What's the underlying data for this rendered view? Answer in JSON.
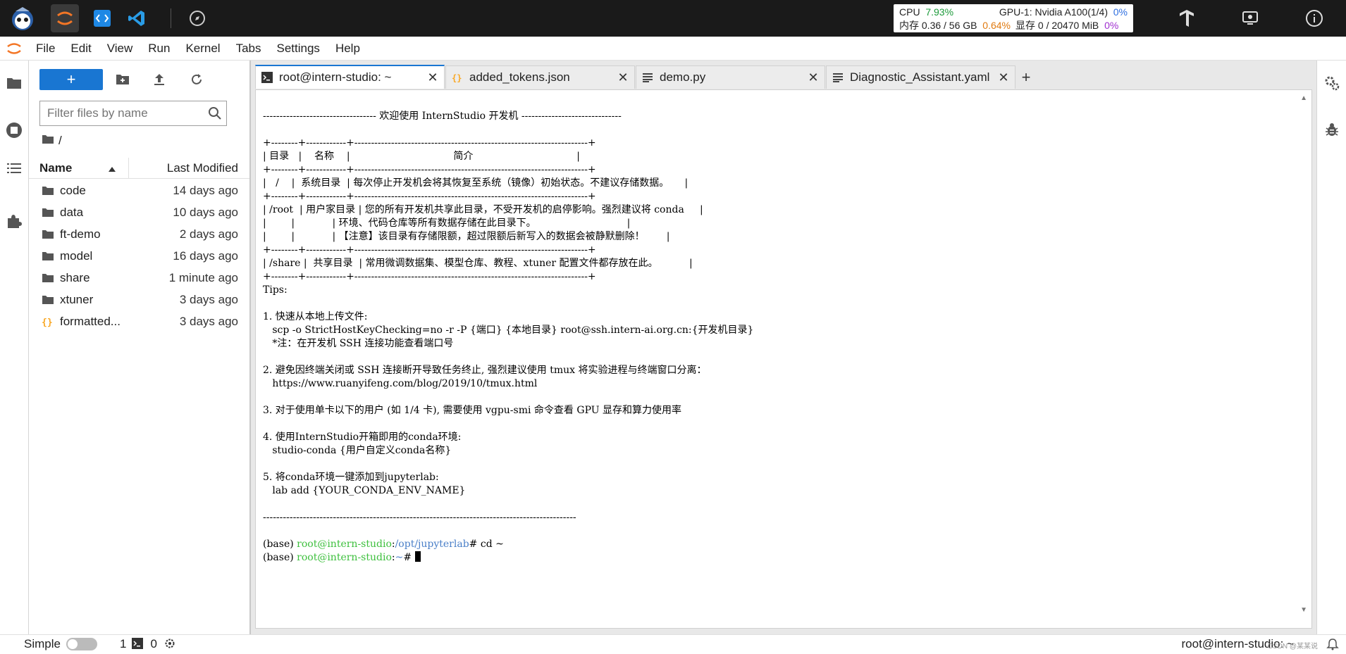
{
  "topbar": {
    "stats": {
      "cpu_label": "CPU",
      "cpu_value": "7.93%",
      "mem_label": "内存 0.36 / 56 GB",
      "mem_value": "0.64%",
      "gpu_label": "GPU-1: Nvidia A100(1/4)",
      "gpu_value": "0%",
      "vram_label": "显存 0 / 20470 MiB",
      "vram_value": "0%"
    }
  },
  "menu": {
    "items": [
      "File",
      "Edit",
      "View",
      "Run",
      "Kernel",
      "Tabs",
      "Settings",
      "Help"
    ]
  },
  "filebrowser": {
    "new_label": "+",
    "filter_placeholder": "Filter files by name",
    "breadcrumb": "/",
    "col_name": "Name",
    "col_modified": "Last Modified",
    "files": [
      {
        "name": "code",
        "modified": "14 days ago",
        "type": "folder"
      },
      {
        "name": "data",
        "modified": "10 days ago",
        "type": "folder"
      },
      {
        "name": "ft-demo",
        "modified": "2 days ago",
        "type": "folder"
      },
      {
        "name": "model",
        "modified": "16 days ago",
        "type": "folder"
      },
      {
        "name": "share",
        "modified": "1 minute ago",
        "type": "folder"
      },
      {
        "name": "xtuner",
        "modified": "3 days ago",
        "type": "folder"
      },
      {
        "name": "formatted...",
        "modified": "3 days ago",
        "type": "json"
      }
    ]
  },
  "tabs": [
    {
      "label": "root@intern-studio: ~",
      "icon": "terminal-icon",
      "active": true
    },
    {
      "label": "added_tokens.json",
      "icon": "json-icon",
      "active": false
    },
    {
      "label": "demo.py",
      "icon": "text-file-icon",
      "active": false
    },
    {
      "label": "Diagnostic_Assistant.yaml",
      "icon": "text-file-icon",
      "active": false
    }
  ],
  "terminal": {
    "lines": [
      "---------------------------------- 欢迎使用 InternStudio 开发机 ------------------------------",
      "",
      "+--------+------------+----------------------------------------------------------------------+",
      "| 目录   |    名称    |                                 简介                                 |",
      "+--------+------------+----------------------------------------------------------------------+",
      "|   /    |  系统目录  | 每次停止开发机会将其恢复至系统（镜像）初始状态。不建议存储数据。     |",
      "+--------+------------+----------------------------------------------------------------------+",
      "| /root  | 用户家目录 | 您的所有开发机共享此目录，不受开发机的启停影响。强烈建议将 conda     |",
      "|        |            | 环境、代码仓库等所有数据存储在此目录下。                             |",
      "|        |            | 【注意】该目录有存储限额，超过限额后新写入的数据会被静默删除！       |",
      "+--------+------------+----------------------------------------------------------------------+",
      "| /share |  共享目录  | 常用微调数据集、模型仓库、教程、xtuner 配置文件都存放在此。          |",
      "+--------+------------+----------------------------------------------------------------------+",
      "Tips:",
      "",
      "1. 快速从本地上传文件:",
      "   scp -o StrictHostKeyChecking=no -r -P {端口} {本地目录} root@ssh.intern-ai.org.cn:{开发机目录}",
      "   *注：在开发机 SSH 连接功能查看端口号",
      "",
      "2. 避免因终端关闭或 SSH 连接断开导致任务终止, 强烈建议使用 tmux 将实验进程与终端窗口分离：",
      "   https://www.ruanyifeng.com/blog/2019/10/tmux.html",
      "",
      "3. 对于使用单卡以下的用户 (如 1/4 卡), 需要使用 vgpu-smi 命令查看 GPU 显存和算力使用率",
      "",
      "4. 使用InternStudio开箱即用的conda环境:",
      "   studio-conda {用户自定义conda名称}",
      "",
      "5. 将conda环境一键添加到jupyterlab:",
      "   lab add {YOUR_CONDA_ENV_NAME}",
      "",
      "----------------------------------------------------------------------------------------------",
      ""
    ],
    "prompt1_env": "(base) ",
    "prompt1_user": "root@intern-studio",
    "prompt1_colon": ":",
    "prompt1_path": "/opt/jupyterlab",
    "prompt1_cmd": "# cd ~",
    "prompt2_env": "(base) ",
    "prompt2_user": "root@intern-studio",
    "prompt2_colon": ":",
    "prompt2_path": "~",
    "prompt2_cmd": "# "
  },
  "statusbar": {
    "simple_label": "Simple",
    "count1": "1",
    "count2": "0",
    "right_text": "root@intern-studio: ~",
    "watermark": "CSDN @某某说"
  },
  "colors": {
    "accent": "#1976d2",
    "topbar": "#1a1a1a",
    "terminal_user": "#3ec03e",
    "terminal_path": "#4a7fc8"
  }
}
